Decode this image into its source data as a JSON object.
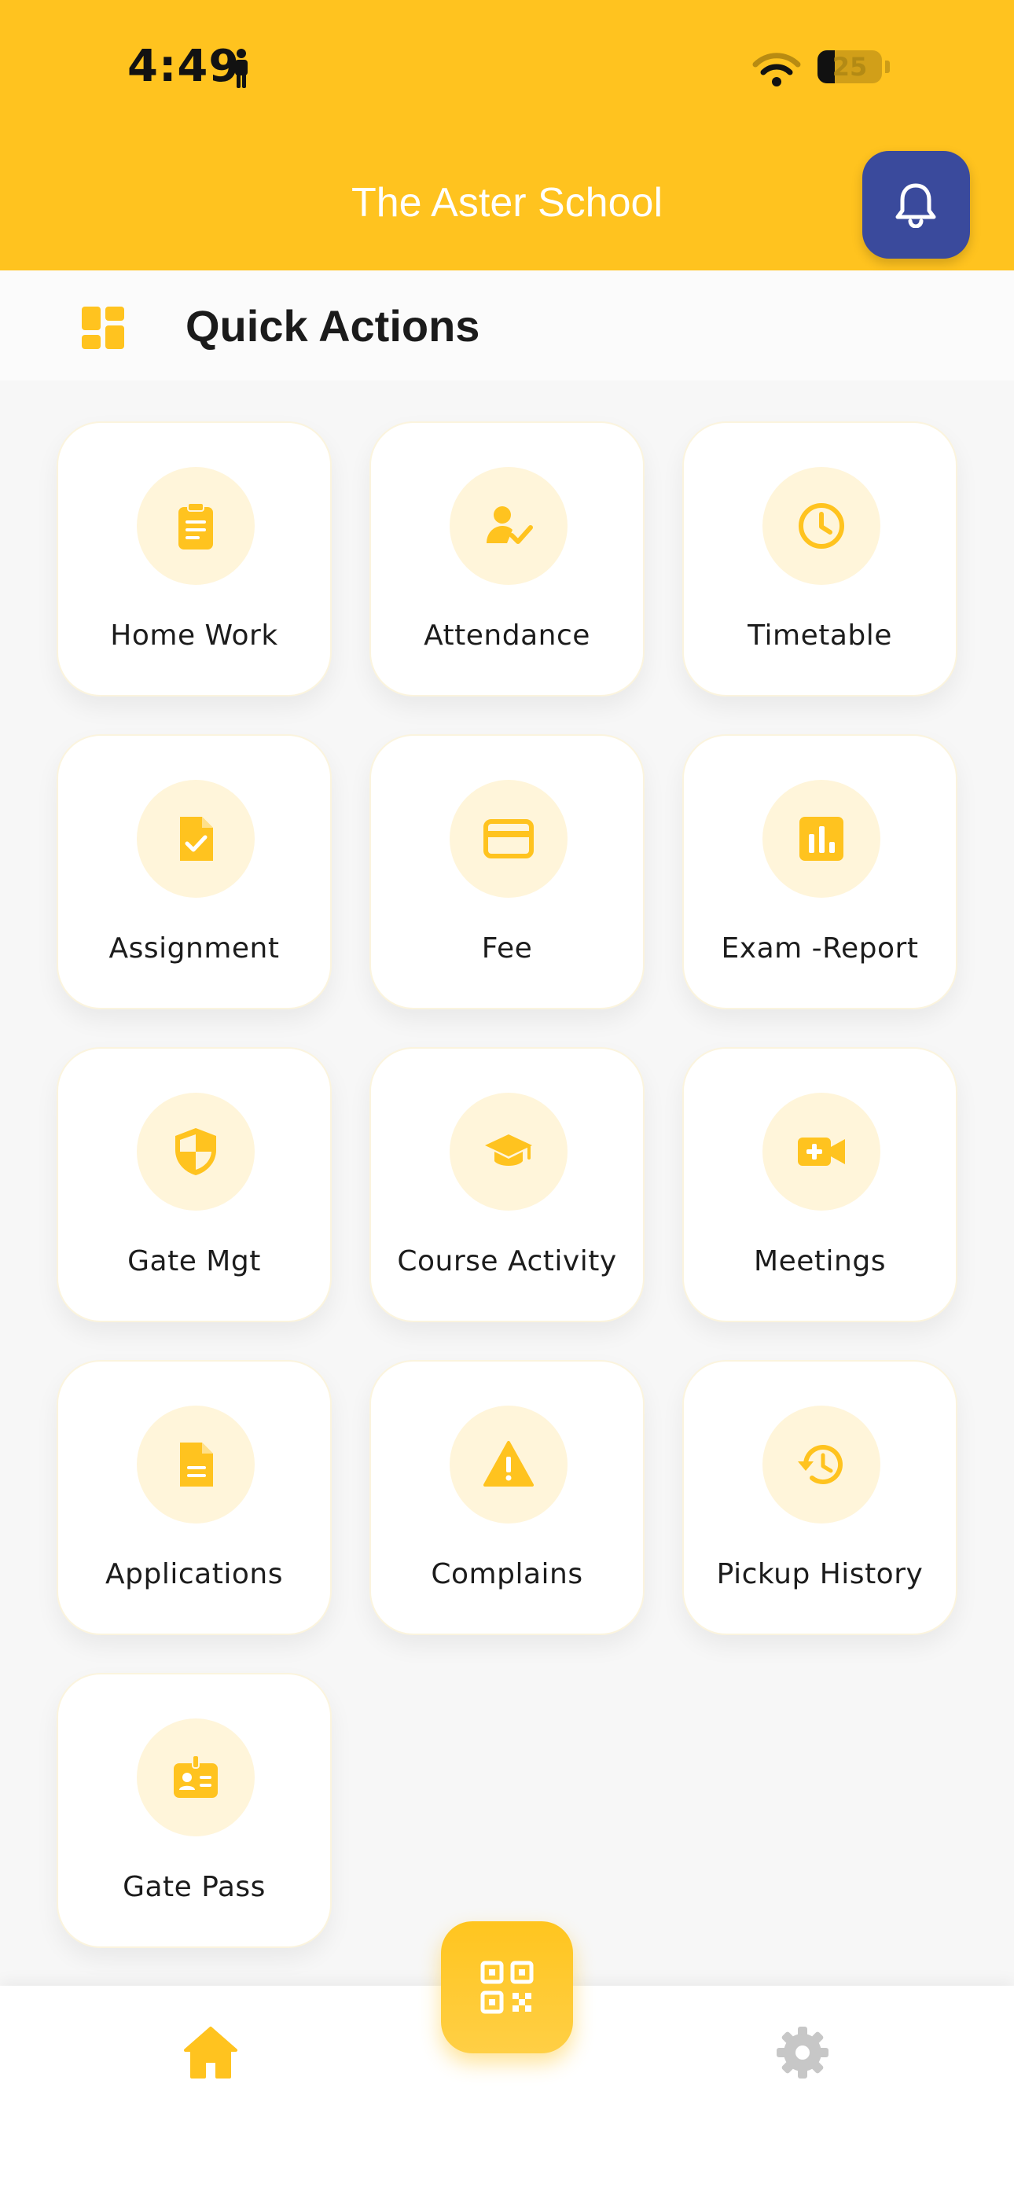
{
  "status_bar": {
    "time": "4:49",
    "battery": "25",
    "icons": [
      "person-icon",
      "wifi-icon",
      "battery-icon"
    ]
  },
  "header": {
    "title": "The Aster School",
    "notification_icon": "bell-icon"
  },
  "section": {
    "title": "Quick Actions",
    "icon": "dashboard-grid-icon"
  },
  "actions": [
    {
      "label": "Home Work",
      "icon": "clipboard-icon"
    },
    {
      "label": "Attendance",
      "icon": "user-check-icon"
    },
    {
      "label": "Timetable",
      "icon": "clock-icon"
    },
    {
      "label": "Assignment",
      "icon": "document-check-icon"
    },
    {
      "label": "Fee",
      "icon": "credit-card-icon"
    },
    {
      "label": "Exam -Report",
      "icon": "bar-chart-icon"
    },
    {
      "label": "Gate Mgt",
      "icon": "shield-icon"
    },
    {
      "label": "Course Activity",
      "icon": "graduation-cap-icon"
    },
    {
      "label": "Meetings",
      "icon": "video-plus-icon"
    },
    {
      "label": "Applications",
      "icon": "document-icon"
    },
    {
      "label": "Complains",
      "icon": "warning-icon"
    },
    {
      "label": "Pickup History",
      "icon": "history-icon"
    },
    {
      "label": "Gate Pass",
      "icon": "id-badge-icon"
    }
  ],
  "bottom_nav": {
    "home_icon": "home-icon",
    "scan_icon": "qr-code-icon",
    "settings_icon": "gear-icon"
  },
  "colors": {
    "primary": "#ffc31f",
    "accent": "#3a4a9c",
    "icon_bg": "#fff5da",
    "inactive": "#c7c7c7"
  }
}
